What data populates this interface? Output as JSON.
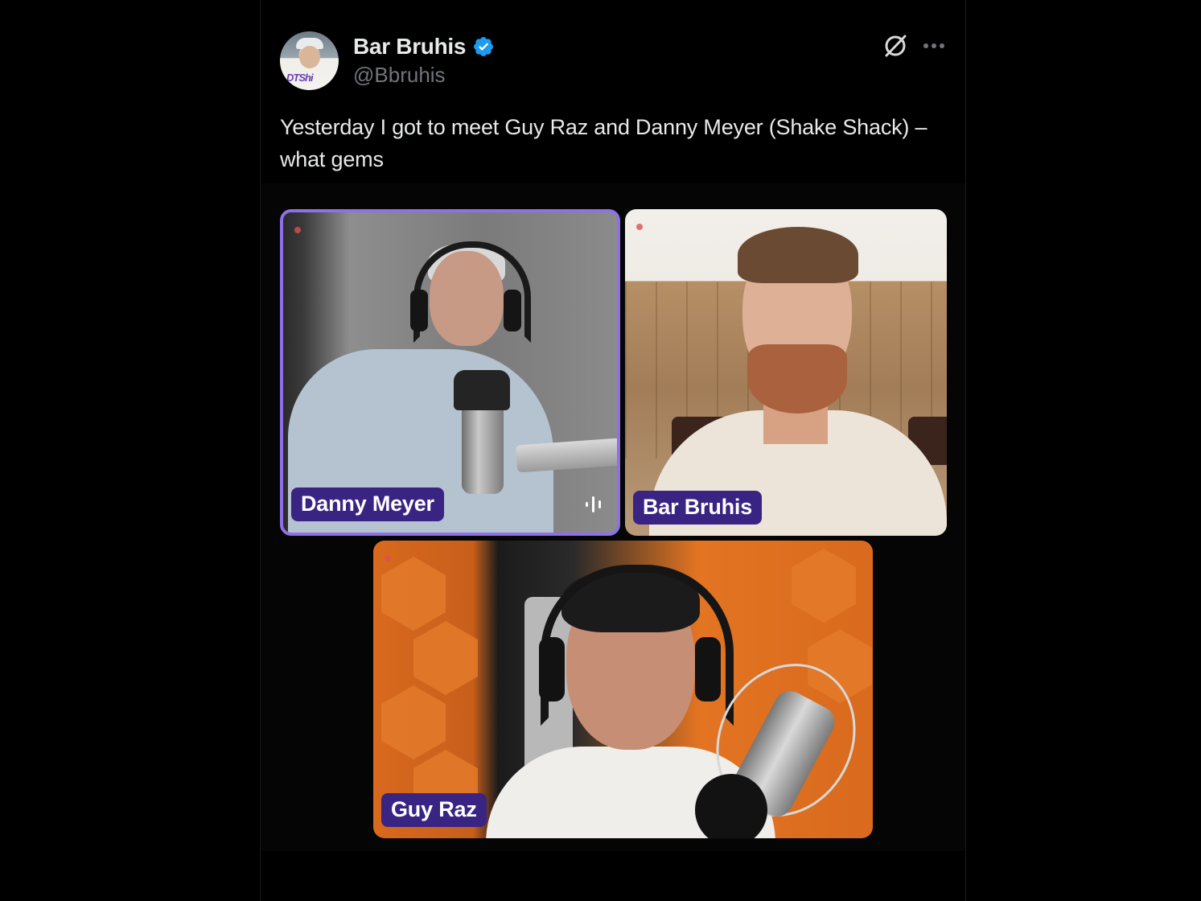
{
  "author": {
    "display_name": "Bar Bruhis",
    "handle": "@Bbruhis",
    "verified": true,
    "avatar_shirt_text": "DTShi"
  },
  "header_icons": {
    "grok": "grok-icon",
    "more": "more-icon",
    "verified": "verified-badge-icon"
  },
  "tweet": {
    "text": "Yesterday I got to meet Guy Raz and Danny Meyer (Shake Shack) – what gems"
  },
  "media": {
    "tiles": [
      {
        "label": "Danny Meyer",
        "active_speaker": true
      },
      {
        "label": "Bar Bruhis",
        "active_speaker": false
      },
      {
        "label": "Guy Raz",
        "active_speaker": false
      }
    ]
  },
  "colors": {
    "background": "#000000",
    "text_primary": "#e7e9ea",
    "text_secondary": "#71767b",
    "verified_blue": "#1d9bf0",
    "label_bg": "#3a2483",
    "active_border": "#8e70e8"
  }
}
